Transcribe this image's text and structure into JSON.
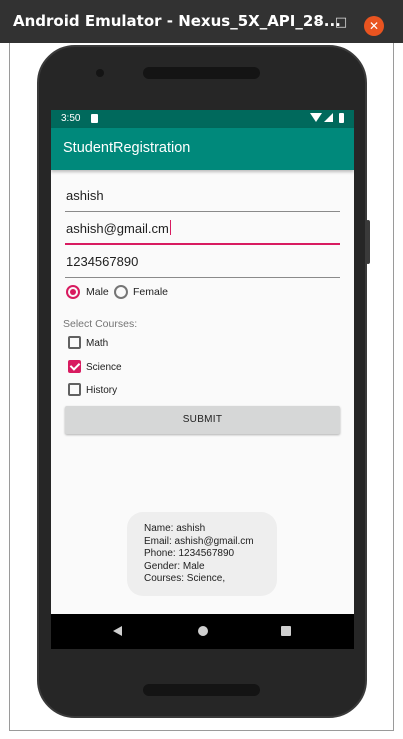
{
  "window": {
    "title": "Android Emulator - Nexus_5X_API_28...",
    "minimize_glyph": "–",
    "maximize_glyph": "□",
    "close_glyph": "✕",
    "close_color": "#e95420"
  },
  "statusbar": {
    "time": "3:50",
    "icons": [
      "sd-card-icon",
      "wifi-icon",
      "signal-icon",
      "battery-icon"
    ]
  },
  "appbar": {
    "title": "StudentRegistration",
    "color": "#00897b"
  },
  "form": {
    "name_value": "ashish",
    "email_value": "ashish@gmail.cm",
    "phone_value": "1234567890",
    "gender": {
      "options": [
        "Male",
        "Female"
      ],
      "selected": "Male"
    },
    "courses_label": "Select Courses:",
    "courses": [
      {
        "label": "Math",
        "checked": false
      },
      {
        "label": "Science",
        "checked": true
      },
      {
        "label": "History",
        "checked": false
      }
    ],
    "submit_label": "SUBMIT",
    "accent_color": "#d81b60"
  },
  "toast": {
    "lines": [
      "Name: ashish",
      "Email: ashish@gmail.cm",
      "Phone: 1234567890",
      "Gender: Male",
      "Courses: Science,"
    ]
  },
  "navbar": {
    "buttons": [
      "back-icon",
      "home-icon",
      "recents-icon"
    ]
  }
}
